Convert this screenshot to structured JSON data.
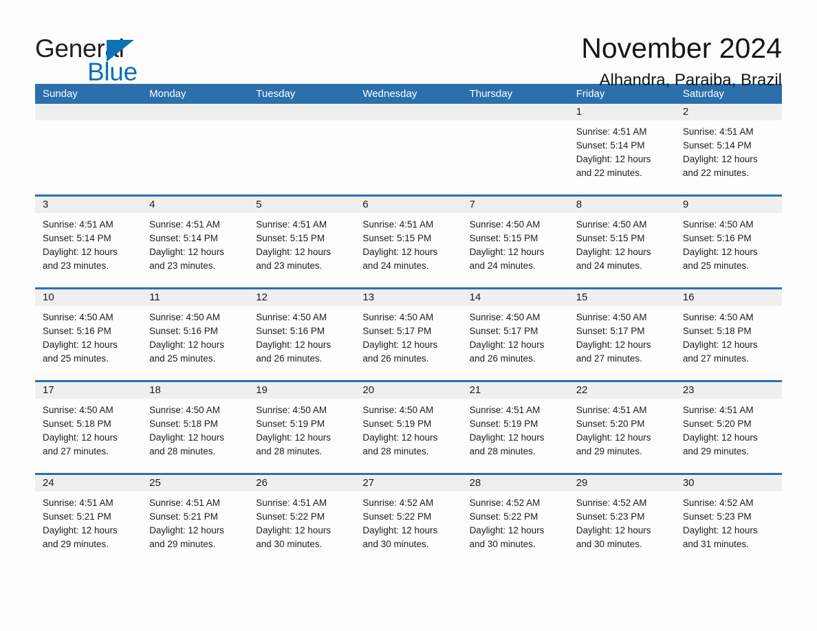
{
  "brand": {
    "line1": "General",
    "line2": "Blue",
    "triangle_icon": "triangle-icon",
    "colors": {
      "text": "#231f20",
      "accent": "#0b72b5"
    }
  },
  "header": {
    "title": "November 2024",
    "location": "Alhandra, Paraiba, Brazil"
  },
  "theme": {
    "header_blue": "#2b6fad",
    "daynum_band": "#efefef",
    "page_bg": "#fdfdfd",
    "text": "#1c1c1c"
  },
  "calendar": {
    "weekday_headers": [
      "Sunday",
      "Monday",
      "Tuesday",
      "Wednesday",
      "Thursday",
      "Friday",
      "Saturday"
    ],
    "labels": {
      "sunrise": "Sunrise:",
      "sunset": "Sunset:",
      "daylight": "Daylight:"
    },
    "weeks": [
      [
        {
          "day": ""
        },
        {
          "day": ""
        },
        {
          "day": ""
        },
        {
          "day": ""
        },
        {
          "day": ""
        },
        {
          "day": "1",
          "sunrise": "Sunrise: 4:51 AM",
          "sunset": "Sunset: 5:14 PM",
          "daylight_l1": "Daylight: 12 hours",
          "daylight_l2": "and 22 minutes."
        },
        {
          "day": "2",
          "sunrise": "Sunrise: 4:51 AM",
          "sunset": "Sunset: 5:14 PM",
          "daylight_l1": "Daylight: 12 hours",
          "daylight_l2": "and 22 minutes."
        }
      ],
      [
        {
          "day": "3",
          "sunrise": "Sunrise: 4:51 AM",
          "sunset": "Sunset: 5:14 PM",
          "daylight_l1": "Daylight: 12 hours",
          "daylight_l2": "and 23 minutes."
        },
        {
          "day": "4",
          "sunrise": "Sunrise: 4:51 AM",
          "sunset": "Sunset: 5:14 PM",
          "daylight_l1": "Daylight: 12 hours",
          "daylight_l2": "and 23 minutes."
        },
        {
          "day": "5",
          "sunrise": "Sunrise: 4:51 AM",
          "sunset": "Sunset: 5:15 PM",
          "daylight_l1": "Daylight: 12 hours",
          "daylight_l2": "and 23 minutes."
        },
        {
          "day": "6",
          "sunrise": "Sunrise: 4:51 AM",
          "sunset": "Sunset: 5:15 PM",
          "daylight_l1": "Daylight: 12 hours",
          "daylight_l2": "and 24 minutes."
        },
        {
          "day": "7",
          "sunrise": "Sunrise: 4:50 AM",
          "sunset": "Sunset: 5:15 PM",
          "daylight_l1": "Daylight: 12 hours",
          "daylight_l2": "and 24 minutes."
        },
        {
          "day": "8",
          "sunrise": "Sunrise: 4:50 AM",
          "sunset": "Sunset: 5:15 PM",
          "daylight_l1": "Daylight: 12 hours",
          "daylight_l2": "and 24 minutes."
        },
        {
          "day": "9",
          "sunrise": "Sunrise: 4:50 AM",
          "sunset": "Sunset: 5:16 PM",
          "daylight_l1": "Daylight: 12 hours",
          "daylight_l2": "and 25 minutes."
        }
      ],
      [
        {
          "day": "10",
          "sunrise": "Sunrise: 4:50 AM",
          "sunset": "Sunset: 5:16 PM",
          "daylight_l1": "Daylight: 12 hours",
          "daylight_l2": "and 25 minutes."
        },
        {
          "day": "11",
          "sunrise": "Sunrise: 4:50 AM",
          "sunset": "Sunset: 5:16 PM",
          "daylight_l1": "Daylight: 12 hours",
          "daylight_l2": "and 25 minutes."
        },
        {
          "day": "12",
          "sunrise": "Sunrise: 4:50 AM",
          "sunset": "Sunset: 5:16 PM",
          "daylight_l1": "Daylight: 12 hours",
          "daylight_l2": "and 26 minutes."
        },
        {
          "day": "13",
          "sunrise": "Sunrise: 4:50 AM",
          "sunset": "Sunset: 5:17 PM",
          "daylight_l1": "Daylight: 12 hours",
          "daylight_l2": "and 26 minutes."
        },
        {
          "day": "14",
          "sunrise": "Sunrise: 4:50 AM",
          "sunset": "Sunset: 5:17 PM",
          "daylight_l1": "Daylight: 12 hours",
          "daylight_l2": "and 26 minutes."
        },
        {
          "day": "15",
          "sunrise": "Sunrise: 4:50 AM",
          "sunset": "Sunset: 5:17 PM",
          "daylight_l1": "Daylight: 12 hours",
          "daylight_l2": "and 27 minutes."
        },
        {
          "day": "16",
          "sunrise": "Sunrise: 4:50 AM",
          "sunset": "Sunset: 5:18 PM",
          "daylight_l1": "Daylight: 12 hours",
          "daylight_l2": "and 27 minutes."
        }
      ],
      [
        {
          "day": "17",
          "sunrise": "Sunrise: 4:50 AM",
          "sunset": "Sunset: 5:18 PM",
          "daylight_l1": "Daylight: 12 hours",
          "daylight_l2": "and 27 minutes."
        },
        {
          "day": "18",
          "sunrise": "Sunrise: 4:50 AM",
          "sunset": "Sunset: 5:18 PM",
          "daylight_l1": "Daylight: 12 hours",
          "daylight_l2": "and 28 minutes."
        },
        {
          "day": "19",
          "sunrise": "Sunrise: 4:50 AM",
          "sunset": "Sunset: 5:19 PM",
          "daylight_l1": "Daylight: 12 hours",
          "daylight_l2": "and 28 minutes."
        },
        {
          "day": "20",
          "sunrise": "Sunrise: 4:50 AM",
          "sunset": "Sunset: 5:19 PM",
          "daylight_l1": "Daylight: 12 hours",
          "daylight_l2": "and 28 minutes."
        },
        {
          "day": "21",
          "sunrise": "Sunrise: 4:51 AM",
          "sunset": "Sunset: 5:19 PM",
          "daylight_l1": "Daylight: 12 hours",
          "daylight_l2": "and 28 minutes."
        },
        {
          "day": "22",
          "sunrise": "Sunrise: 4:51 AM",
          "sunset": "Sunset: 5:20 PM",
          "daylight_l1": "Daylight: 12 hours",
          "daylight_l2": "and 29 minutes."
        },
        {
          "day": "23",
          "sunrise": "Sunrise: 4:51 AM",
          "sunset": "Sunset: 5:20 PM",
          "daylight_l1": "Daylight: 12 hours",
          "daylight_l2": "and 29 minutes."
        }
      ],
      [
        {
          "day": "24",
          "sunrise": "Sunrise: 4:51 AM",
          "sunset": "Sunset: 5:21 PM",
          "daylight_l1": "Daylight: 12 hours",
          "daylight_l2": "and 29 minutes."
        },
        {
          "day": "25",
          "sunrise": "Sunrise: 4:51 AM",
          "sunset": "Sunset: 5:21 PM",
          "daylight_l1": "Daylight: 12 hours",
          "daylight_l2": "and 29 minutes."
        },
        {
          "day": "26",
          "sunrise": "Sunrise: 4:51 AM",
          "sunset": "Sunset: 5:22 PM",
          "daylight_l1": "Daylight: 12 hours",
          "daylight_l2": "and 30 minutes."
        },
        {
          "day": "27",
          "sunrise": "Sunrise: 4:52 AM",
          "sunset": "Sunset: 5:22 PM",
          "daylight_l1": "Daylight: 12 hours",
          "daylight_l2": "and 30 minutes."
        },
        {
          "day": "28",
          "sunrise": "Sunrise: 4:52 AM",
          "sunset": "Sunset: 5:22 PM",
          "daylight_l1": "Daylight: 12 hours",
          "daylight_l2": "and 30 minutes."
        },
        {
          "day": "29",
          "sunrise": "Sunrise: 4:52 AM",
          "sunset": "Sunset: 5:23 PM",
          "daylight_l1": "Daylight: 12 hours",
          "daylight_l2": "and 30 minutes."
        },
        {
          "day": "30",
          "sunrise": "Sunrise: 4:52 AM",
          "sunset": "Sunset: 5:23 PM",
          "daylight_l1": "Daylight: 12 hours",
          "daylight_l2": "and 31 minutes."
        }
      ]
    ]
  }
}
